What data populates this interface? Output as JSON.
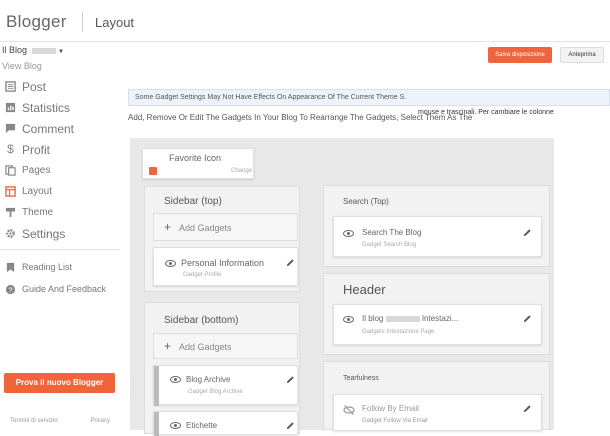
{
  "app": {
    "brand": "Blogger",
    "page_title": "Layout"
  },
  "sidebar": {
    "blog_selector": "Il Blog",
    "view_blog": "View Blog",
    "items": [
      {
        "label": "Post",
        "icon": "post-icon"
      },
      {
        "label": "Statistics",
        "icon": "statistics-icon"
      },
      {
        "label": "Comment",
        "icon": "comment-icon"
      },
      {
        "label": "Profit",
        "icon": "dollar-icon"
      },
      {
        "label": "Pages",
        "icon": "pages-icon"
      },
      {
        "label": "Layout",
        "icon": "layout-icon"
      },
      {
        "label": "Theme",
        "icon": "theme-icon"
      },
      {
        "label": "Settings",
        "icon": "gear-icon"
      }
    ],
    "secondary": [
      {
        "label": "Reading List",
        "icon": "bookmark-icon"
      },
      {
        "label": "Guide And Feedback",
        "icon": "help-icon"
      }
    ],
    "new_blogger_button": "Prova il nuovo Blogger",
    "footer": {
      "terms": "Termini di servizio",
      "privacy": "Privacy"
    }
  },
  "toolbar": {
    "save_label": "Salva disposizione",
    "preview_label": "Anteprima"
  },
  "info_banner": "Some Gadget Settings May Not Have Effects On Appearance Of The Current Theme S.",
  "instructions": {
    "text": "Add, Remove Or Edit The Gadgets In Your Blog To Rearrange The Gadgets, Select Them As The",
    "text2": "mouse e trascinali. Per cambiare le colonne"
  },
  "layout": {
    "favorite_icon": {
      "title": "Favorite Icon",
      "change": "Change"
    },
    "sidebar_top": {
      "title": "Sidebar (top)",
      "add_label": "Add Gadgets",
      "gadgets": [
        {
          "title": "Personal Information",
          "sub": "Gadget Profile"
        }
      ]
    },
    "sidebar_bottom": {
      "title": "Sidebar (bottom)",
      "add_label": "Add Gadgets",
      "gadgets": [
        {
          "title": "Blog Archive",
          "sub": "Gadget Blog Archive"
        },
        {
          "title": "Etichette",
          "sub": ""
        }
      ]
    },
    "search_top": {
      "title": "Search (Top)",
      "gadgets": [
        {
          "title": "Search The Blog",
          "sub": "Gadget Search Blog"
        }
      ]
    },
    "header": {
      "title": "Header",
      "gadgets": [
        {
          "title": "Il blog",
          "title2": "Intestazi...",
          "sub": "Gadgets Intestazione Page"
        }
      ]
    },
    "tearfulness": {
      "title": "Tearfulness",
      "gadgets": [
        {
          "title": "Follow By Email",
          "sub": "Gadget Follow Via Email"
        }
      ]
    }
  },
  "colors": {
    "accent": "#f0643c",
    "banner_bg": "#eef3fb"
  }
}
